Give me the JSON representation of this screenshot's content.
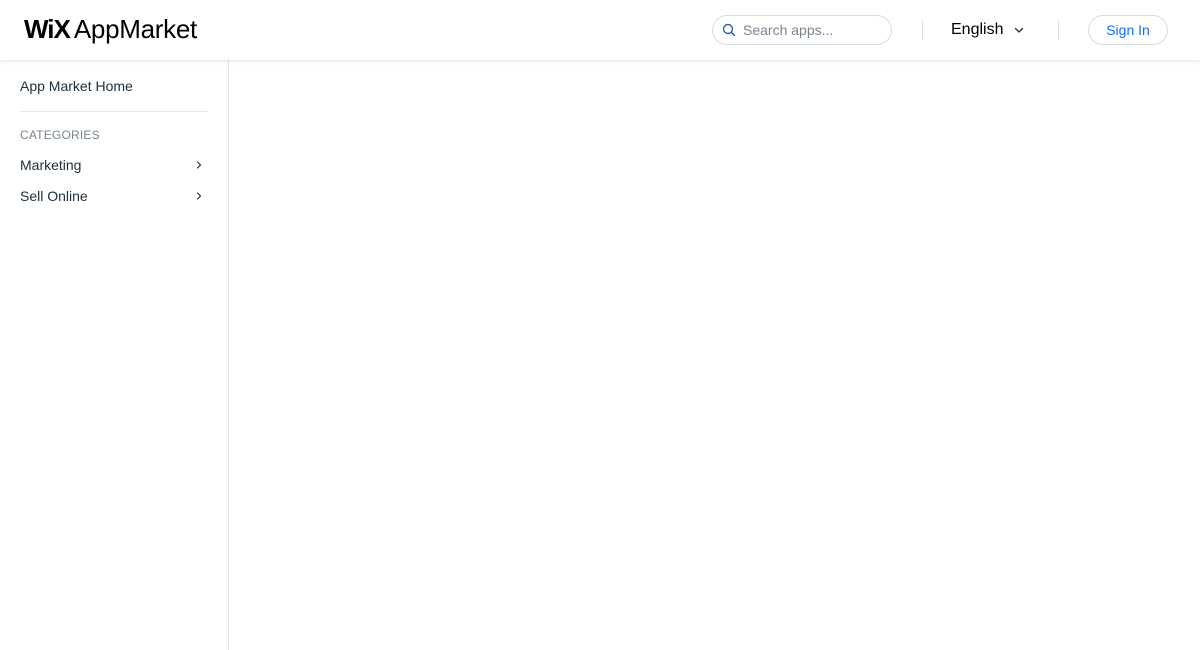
{
  "header": {
    "logo_wix": "WiX",
    "logo_text": "AppMarket",
    "search": {
      "placeholder": "Search apps...",
      "value": ""
    },
    "language": "English",
    "sign_in_label": "Sign In"
  },
  "sidebar": {
    "home_label": "App Market Home",
    "categories_title": "CATEGORIES",
    "items": [
      {
        "label": "Marketing"
      },
      {
        "label": "Sell Online"
      }
    ]
  },
  "colors": {
    "accent": "#116dff",
    "text": "#20303c",
    "muted": "#7a8590",
    "border": "#e3e7ec"
  },
  "icons": {
    "search": "search-icon",
    "language_dropdown": "chevron-down-icon",
    "category_expand": "chevron-right-icon"
  }
}
